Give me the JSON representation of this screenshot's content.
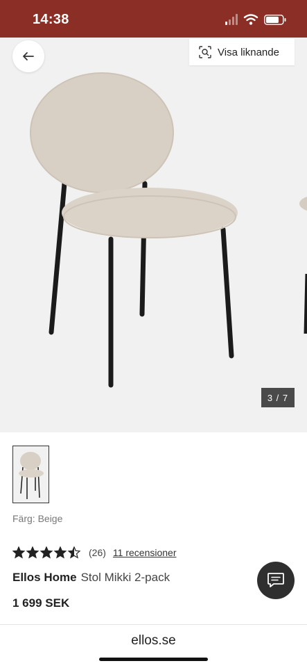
{
  "status": {
    "time": "14:38"
  },
  "gallery": {
    "similar_label": "Visa liknande",
    "counter": "3 / 7"
  },
  "product": {
    "color_line": "Färg: Beige",
    "rating": 4.5,
    "rating_count": "(26)",
    "reviews_link": "11 recensioner",
    "brand": "Ellos Home",
    "name": "Stol Mikki 2-pack",
    "price": "1 699 SEK"
  },
  "browser": {
    "url": "ellos.se"
  },
  "colors": {
    "status_bar": "#8b2f26",
    "chair_fabric": "#d9d0c5",
    "chat_button": "#2f2f2f"
  },
  "icons": [
    "wifi-icon",
    "battery-icon",
    "signal-icon",
    "back-arrow-icon",
    "visual-search-icon",
    "star-icon",
    "chat-icon"
  ]
}
